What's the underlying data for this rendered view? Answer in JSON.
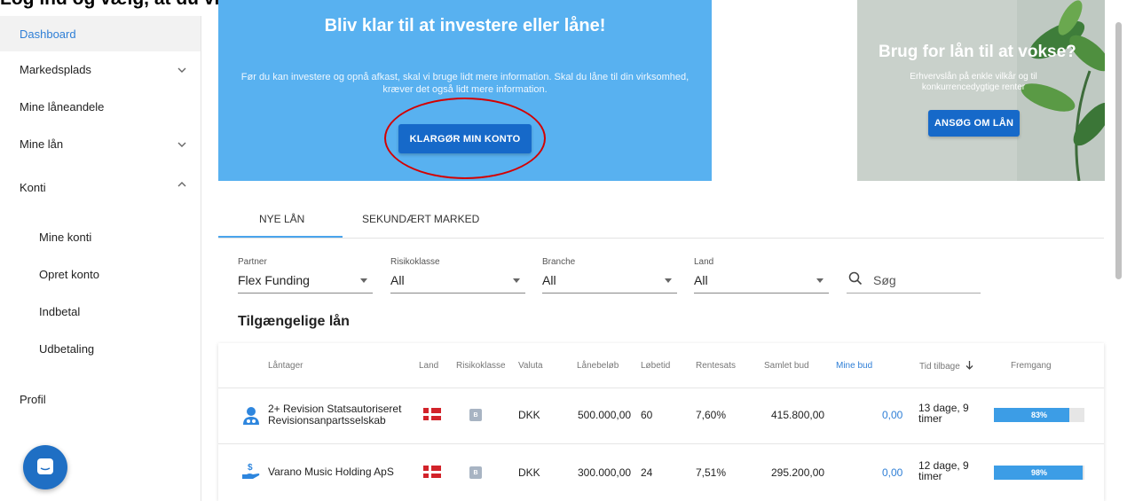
{
  "caption": "Log ind og vælg, at du vil investere via en personlig konto",
  "sidebar": {
    "items": [
      {
        "label": "Dashboard"
      },
      {
        "label": "Markedsplads"
      },
      {
        "label": "Mine låneandele"
      },
      {
        "label": "Mine lån"
      },
      {
        "label": "Konti"
      },
      {
        "label": "Mine konti"
      },
      {
        "label": "Opret konto"
      },
      {
        "label": "Indbetal"
      },
      {
        "label": "Udbetaling"
      },
      {
        "label": "Profil"
      }
    ]
  },
  "banner": {
    "title": "Bliv klar til at investere eller låne!",
    "text": "Før du kan investere og opnå afkast, skal vi bruge lidt mere information. Skal du låne til din virksomhed, kræver det også lidt mere information.",
    "button": "KLARGØR MIN KONTO"
  },
  "promo": {
    "title": "Brug for lån til at vokse?",
    "text": "Erhvervslån på enkle vilkår og til konkurrencedygtige renter",
    "button": "ANSØG OM LÅN"
  },
  "tabs": [
    {
      "label": "NYE LÅN"
    },
    {
      "label": "SEKUNDÆRT MARKED"
    }
  ],
  "filters": {
    "partner": {
      "label": "Partner",
      "value": "Flex Funding"
    },
    "risk": {
      "label": "Risikoklasse",
      "value": "All"
    },
    "industry": {
      "label": "Branche",
      "value": "All"
    },
    "country": {
      "label": "Land",
      "value": "All"
    },
    "search_placeholder": "Søg"
  },
  "section_title": "Tilgængelige lån",
  "table": {
    "headers": {
      "borrower": "Låntager",
      "country": "Land",
      "risk": "Risikoklasse",
      "currency": "Valuta",
      "amount": "Lånebeløb",
      "term": "Løbetid",
      "rate": "Rentesats",
      "total_bids": "Samlet bud",
      "my_bids": "Mine bud",
      "time_left": "Tid tilbage",
      "progress": "Fremgang"
    },
    "rows": [
      {
        "borrower_line1": "2+ Revision Statsautoriseret",
        "borrower_line2": "Revisionsanpartsselskab",
        "risk": "B",
        "currency": "DKK",
        "amount": "500.000,00",
        "term": "60",
        "rate": "7,60%",
        "total_bids": "415.800,00",
        "my_bids": "0,00",
        "time_line1": "13 dage, 9",
        "time_line2": "timer",
        "progress": 0.83,
        "progress_label": "83%"
      },
      {
        "borrower_line1": "Varano Music Holding ApS",
        "borrower_line2": "",
        "risk": "B",
        "currency": "DKK",
        "amount": "300.000,00",
        "term": "24",
        "rate": "7,51%",
        "total_bids": "295.200,00",
        "my_bids": "0,00",
        "time_line1": "12 dage, 9",
        "time_line2": "timer",
        "progress": 0.98,
        "progress_label": "98%"
      }
    ]
  },
  "colors": {
    "banner_bg": "#58b1f0",
    "button_bg": "#1669c9",
    "accent": "#2f7fd6",
    "annotation": "#d40000"
  }
}
